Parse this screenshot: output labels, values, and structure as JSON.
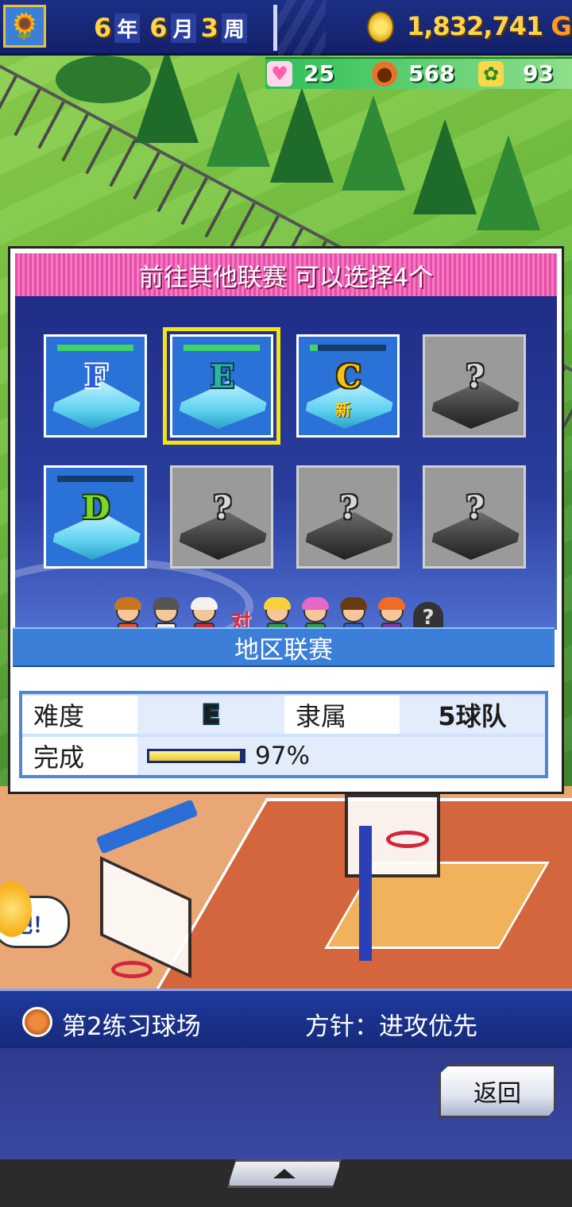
{
  "hud": {
    "season_icon": "sunflower-icon",
    "year": "6",
    "year_unit": "年",
    "month": "6",
    "month_unit": "月",
    "week": "3",
    "week_unit": "周",
    "money_value": "1,832,741",
    "money_unit": "G",
    "stats": [
      {
        "icon": "heart-icon",
        "value": "25",
        "color": "#ff6fb5"
      },
      {
        "icon": "basketball-icon",
        "value": "568",
        "color": "#e5742a"
      },
      {
        "icon": "sprout-icon",
        "value": "93",
        "color": "#48b84a"
      }
    ]
  },
  "dialog": {
    "title": "前往其他联赛  可以选择4个",
    "leagues": [
      {
        "grade": "F",
        "state": "unlocked",
        "progress": 1.0,
        "style": "blue"
      },
      {
        "grade": "E",
        "state": "unlocked",
        "progress": 1.0,
        "style": "teal",
        "selected": true
      },
      {
        "grade": "C",
        "state": "unlocked",
        "progress": 0.1,
        "style": "gold",
        "new_label": "新"
      },
      {
        "grade": "?",
        "state": "locked"
      },
      {
        "grade": "D",
        "state": "unlocked",
        "progress": 0.0,
        "style": "green"
      },
      {
        "grade": "?",
        "state": "locked"
      },
      {
        "grade": "?",
        "state": "locked"
      },
      {
        "grade": "?",
        "state": "locked"
      }
    ],
    "vs_label": "对",
    "league_name": "地区联赛",
    "info": {
      "difficulty_label": "难度",
      "difficulty_value": "E",
      "affiliation_label": "隶属",
      "affiliation_value": "5球队",
      "completion_label": "完成",
      "completion_fraction": 0.97,
      "completion_text": "97%"
    }
  },
  "status": {
    "court_name": "第2练习球场",
    "policy": "方针：进攻优先"
  },
  "buttons": {
    "back": "返回"
  },
  "background": {
    "bubble_text": "吧！"
  }
}
